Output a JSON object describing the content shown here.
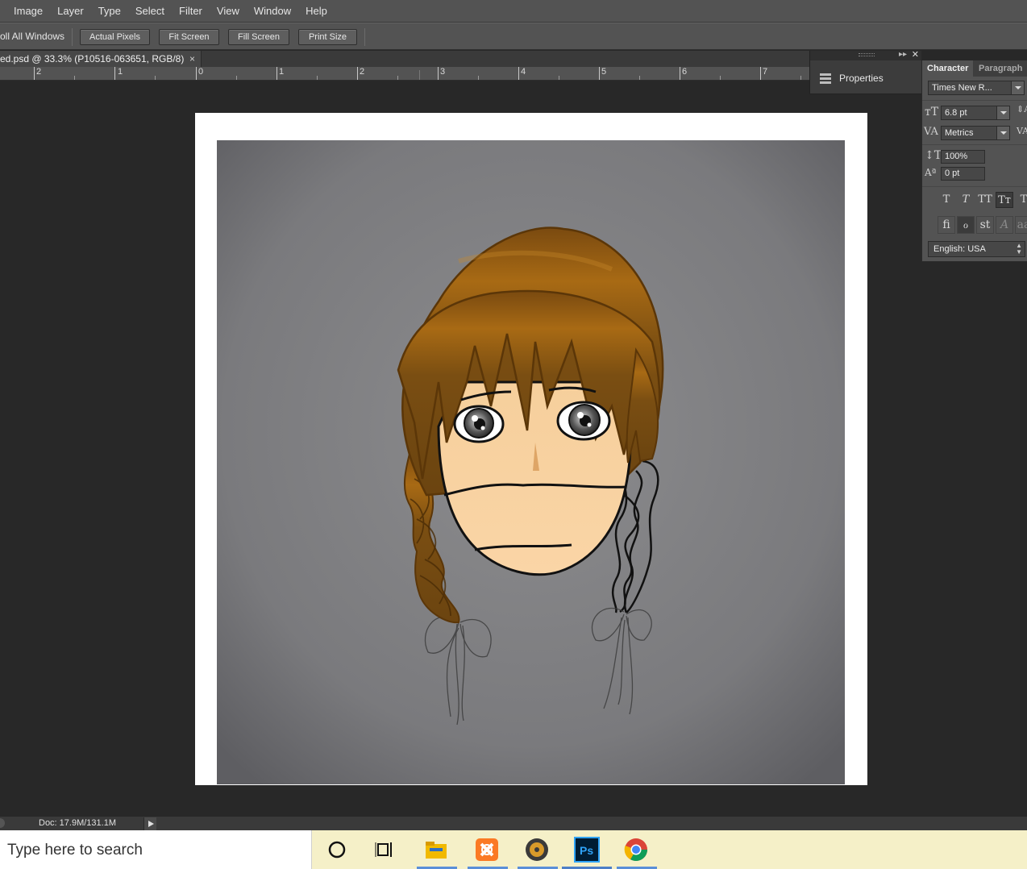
{
  "menubar": {
    "items": [
      "Image",
      "Layer",
      "Type",
      "Select",
      "Filter",
      "View",
      "Window",
      "Help"
    ]
  },
  "options": {
    "scroll_all": "oll All Windows",
    "buttons": [
      "Actual Pixels",
      "Fit Screen",
      "Fill Screen",
      "Print Size"
    ]
  },
  "document": {
    "tab_title": "ed.psd @ 33.3% (P10516-063651, RGB/8)",
    "tab_close": "×"
  },
  "ruler": {
    "labels": [
      "2",
      "1",
      "0",
      "1",
      "2",
      "3",
      "4",
      "5",
      "6",
      "7"
    ]
  },
  "status": {
    "doc": "Doc: 17.9M/131.1M"
  },
  "properties": {
    "label": "Properties"
  },
  "character": {
    "tab_active": "Character",
    "tab_inactive": "Paragraph",
    "font_family": "Times New R...",
    "font_size": "6.8 pt",
    "kerning": "Metrics",
    "vertical_scale": "100%",
    "baseline_shift": "0 pt",
    "type_styles": [
      "T",
      "T",
      "TT",
      "Tт",
      "T"
    ],
    "ligatures": [
      "fi",
      "ℴ",
      "st",
      "A",
      "aa"
    ],
    "language": "English: USA"
  },
  "taskbar": {
    "search_placeholder": "Type here to search"
  }
}
